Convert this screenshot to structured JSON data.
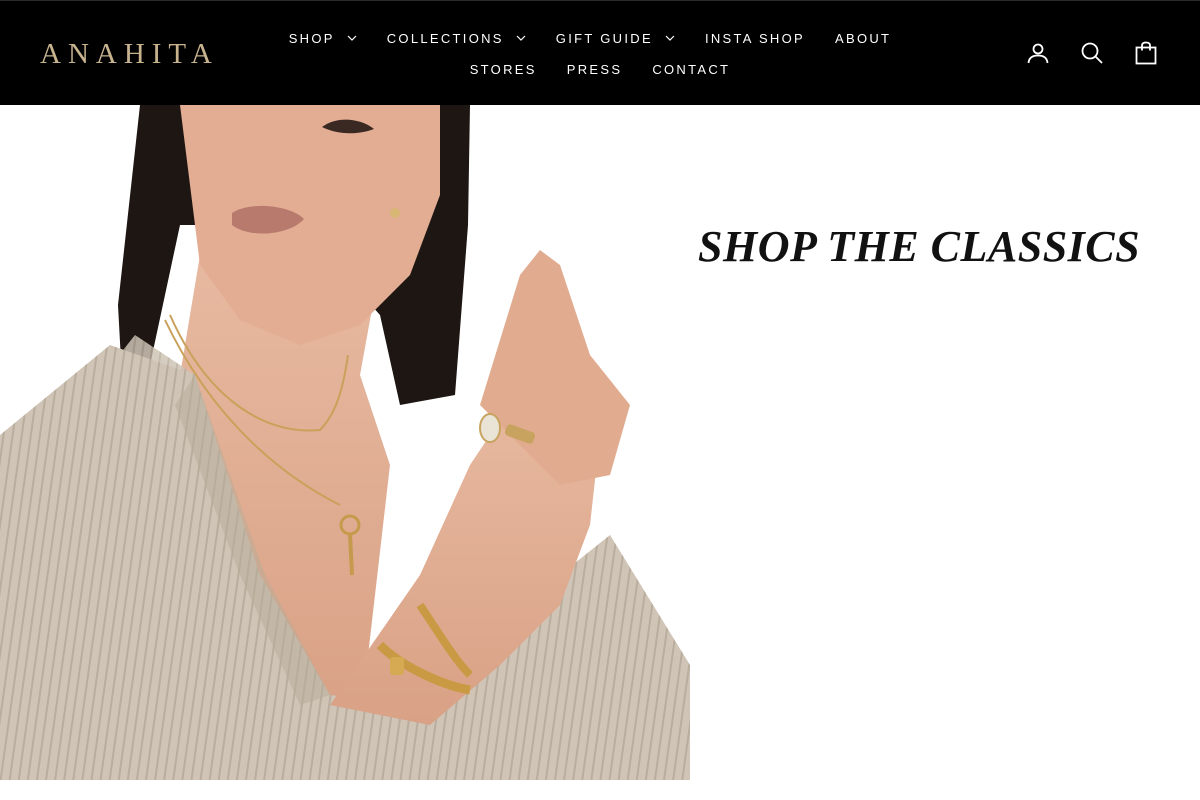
{
  "brand": {
    "name": "ANAHITA",
    "logo_color": "#c8b38f"
  },
  "nav": {
    "row1": [
      {
        "label": "SHOP",
        "dropdown": true
      },
      {
        "label": "COLLECTIONS",
        "dropdown": true
      },
      {
        "label": "GIFT GUIDE",
        "dropdown": true
      },
      {
        "label": "INSTA SHOP",
        "dropdown": false
      },
      {
        "label": "ABOUT",
        "dropdown": false
      }
    ],
    "row2": [
      {
        "label": "STORES"
      },
      {
        "label": "PRESS"
      },
      {
        "label": "CONTACT"
      }
    ]
  },
  "header_icons": {
    "account": {
      "icon": "user-icon",
      "label": "LOG IN"
    },
    "search": {
      "icon": "search-icon",
      "label": "SEARCH"
    },
    "cart": {
      "icon": "bag-icon",
      "label": "CART"
    }
  },
  "hero": {
    "title": "SHOP THE CLASSICS",
    "image": "model-wearing-gold-jewelry"
  },
  "colors": {
    "header_bg": "#000000",
    "text_light": "#ffffff",
    "accent_gold": "#c8b38f"
  }
}
